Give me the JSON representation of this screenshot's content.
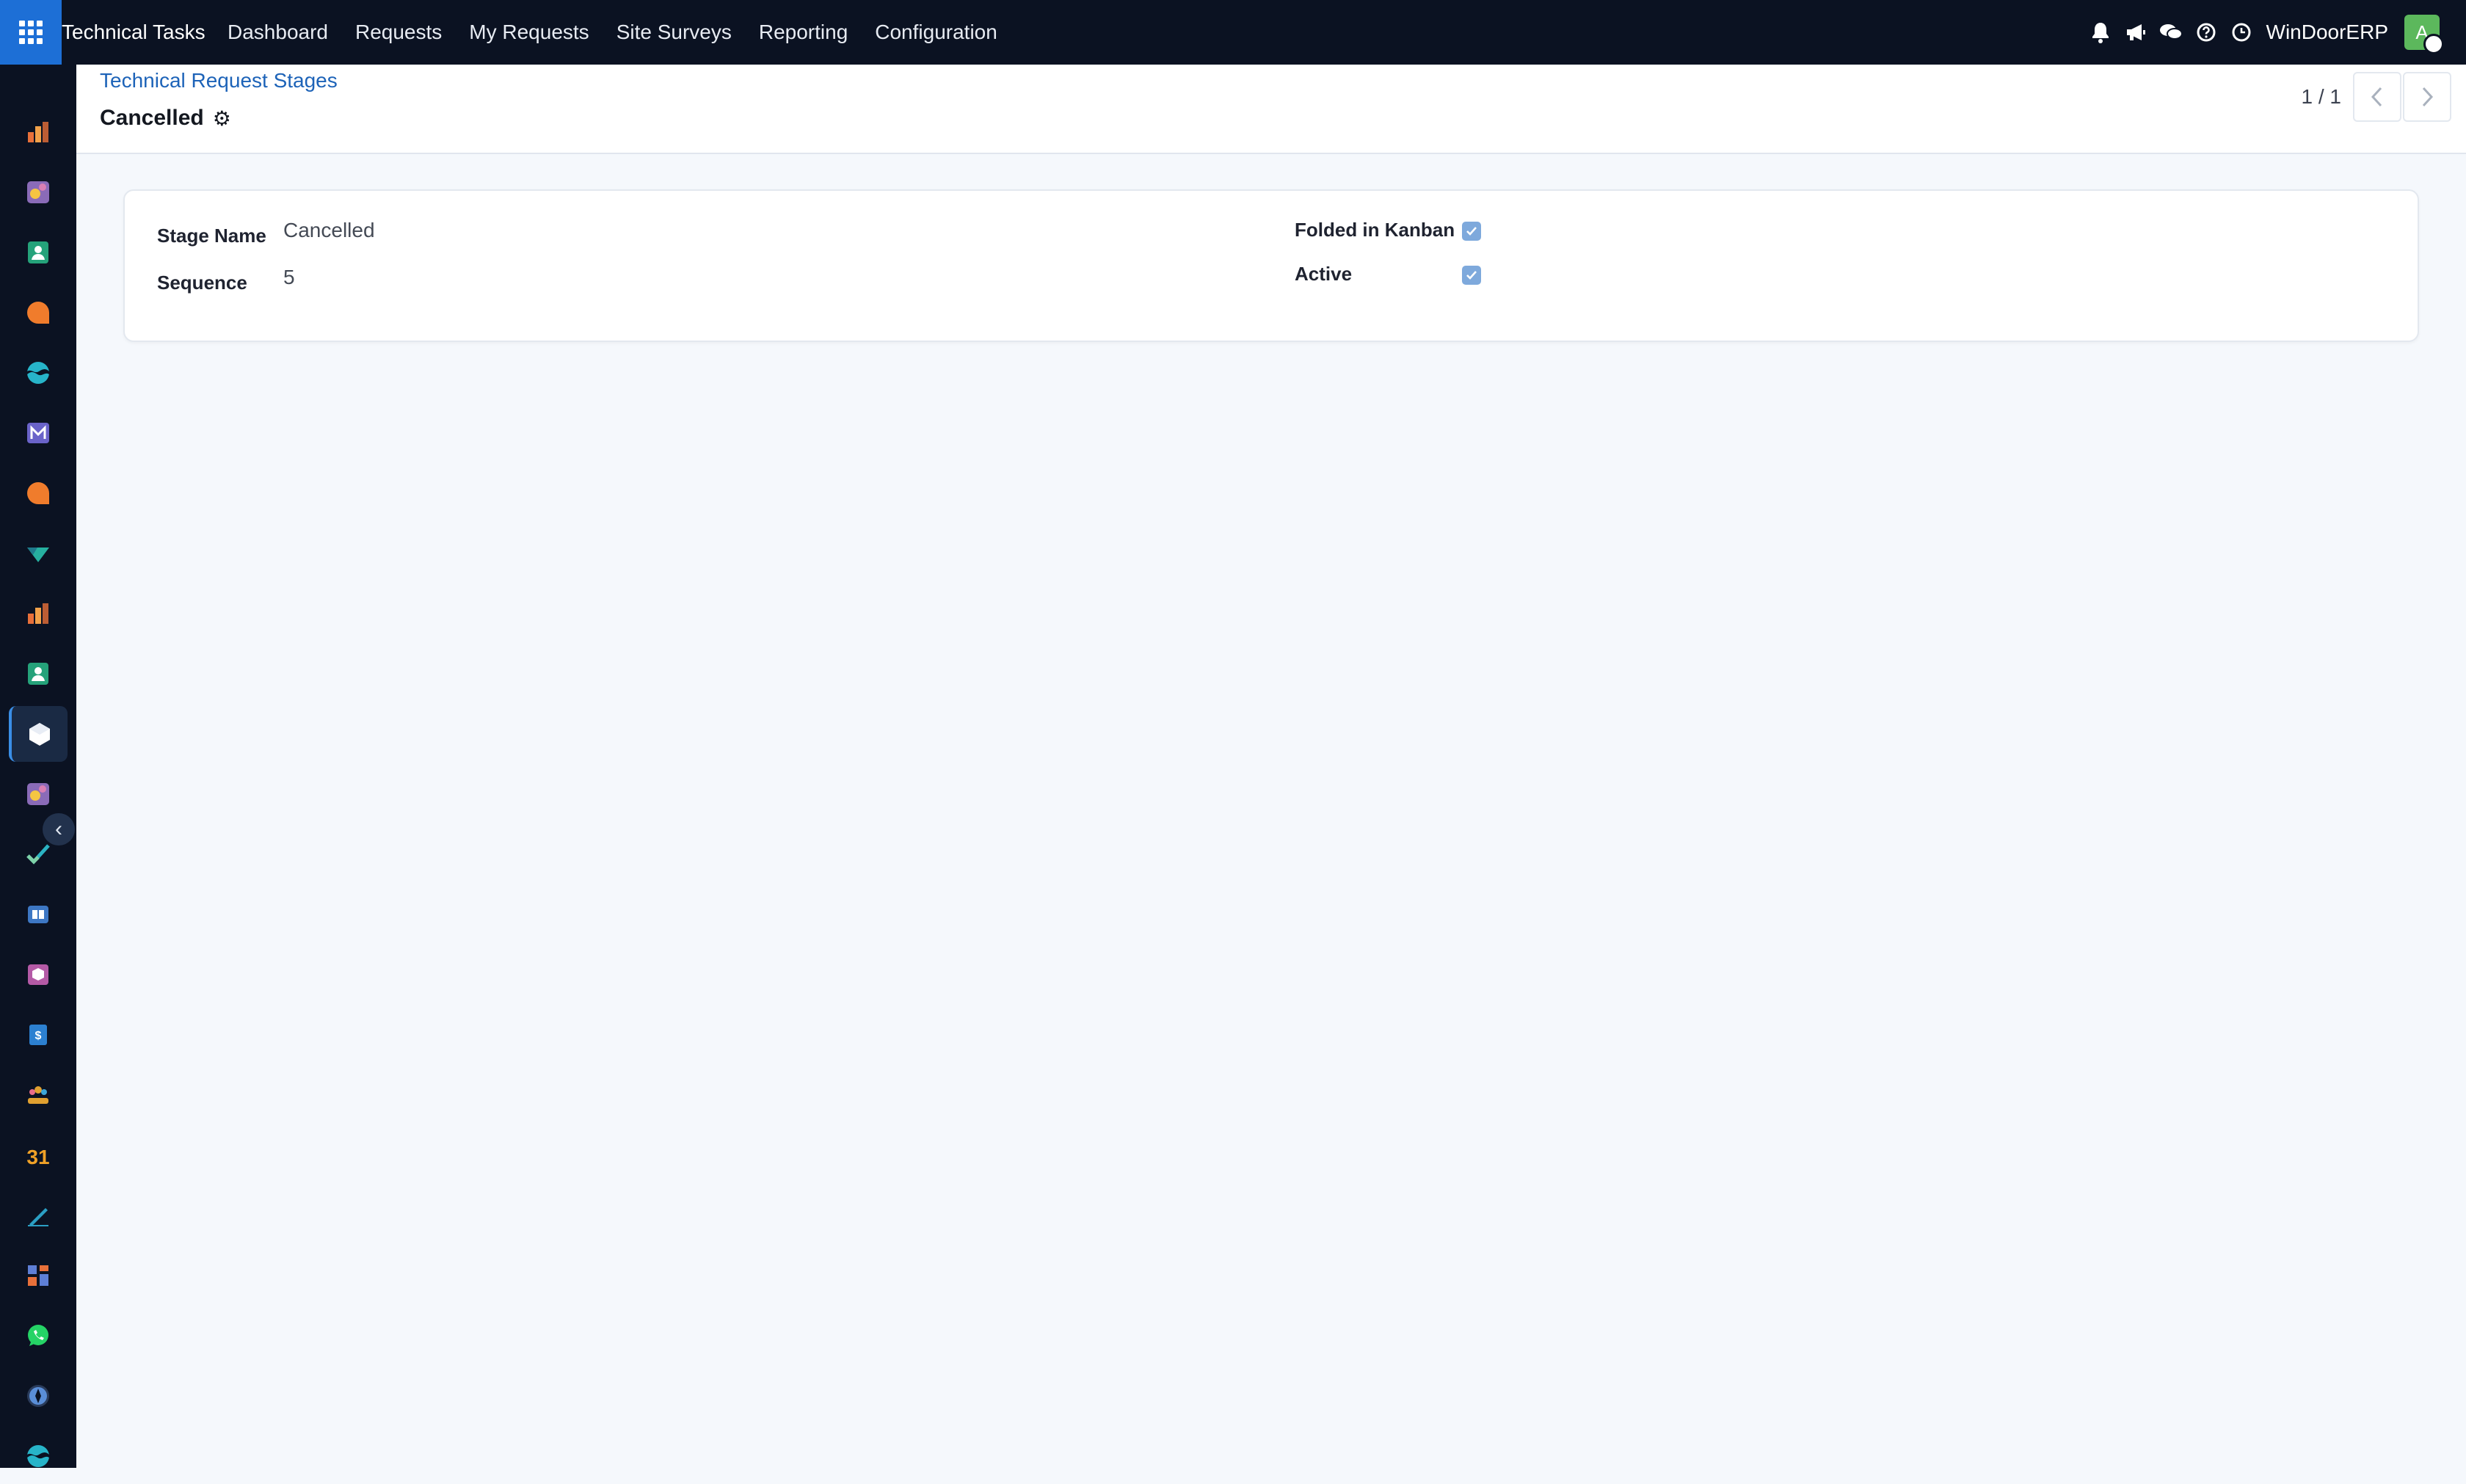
{
  "topbar": {
    "apps_icon": "apps-grid-icon",
    "app_title": "Technical Tasks",
    "nav": [
      "Dashboard",
      "Requests",
      "My Requests",
      "Site Surveys",
      "Reporting",
      "Configuration"
    ],
    "systray_icons": [
      "bell-icon",
      "megaphone-icon",
      "chat-icon",
      "help-icon",
      "clock-icon"
    ],
    "company": "WinDoorERP",
    "avatar_letter": "A",
    "avatar_color": "#5cb85c"
  },
  "sidebar": {
    "active_index": 10,
    "collapse_icon": "chevron-left-icon",
    "items": [
      {
        "icon": "bar-chart-icon",
        "color": "#e8703a"
      },
      {
        "icon": "palette-icon",
        "color": "#d97fb4"
      },
      {
        "icon": "contacts-icon",
        "color": "#25a27a"
      },
      {
        "icon": "chat-bubble-icon",
        "color": "#f07c2c"
      },
      {
        "icon": "wave-icon",
        "color": "#27b4c9"
      },
      {
        "icon": "mail-icon",
        "color": "#6a63c9"
      },
      {
        "icon": "chat-bubble-icon",
        "color": "#f07c2c"
      },
      {
        "icon": "check-ribbon-icon",
        "color": "#26b0a0"
      },
      {
        "icon": "bar-chart-icon",
        "color": "#e8703a"
      },
      {
        "icon": "contacts-icon",
        "color": "#25a27a"
      },
      {
        "icon": "cube-icon",
        "color": "#ffffff"
      },
      {
        "icon": "palette-icon",
        "color": "#d97fb4"
      },
      {
        "icon": "checkmark-icon",
        "color": "#2bb3c3"
      },
      {
        "icon": "book-icon",
        "color": "#3d77c4"
      },
      {
        "icon": "box-icon",
        "color": "#b45aa6"
      },
      {
        "icon": "invoice-icon",
        "color": "#2c80d1"
      },
      {
        "icon": "team-icon",
        "color": "#e0a030"
      },
      {
        "icon": "calendar-31-icon",
        "color": "#f0a127"
      },
      {
        "icon": "pen-icon",
        "color": "#2b9fc4"
      },
      {
        "icon": "dashboard-icon",
        "color": "#5e7fd6"
      },
      {
        "icon": "whatsapp-icon",
        "color": "#25d366"
      },
      {
        "icon": "compass-icon",
        "color": "#5a8ed8"
      },
      {
        "icon": "wave-icon",
        "color": "#27b4c9"
      }
    ]
  },
  "control_panel": {
    "breadcrumb": "Technical Request Stages",
    "record_title": "Cancelled",
    "settings_icon": "gear-icon",
    "pager_value": "1 / 1",
    "prev_icon": "chevron-left-icon",
    "next_icon": "chevron-right-icon"
  },
  "form": {
    "stage_name_label": "Stage Name",
    "stage_name_value": "Cancelled",
    "sequence_label": "Sequence",
    "sequence_value": "5",
    "folded_label": "Folded in Kanban",
    "folded_checked": true,
    "active_label": "Active",
    "active_checked": true
  }
}
